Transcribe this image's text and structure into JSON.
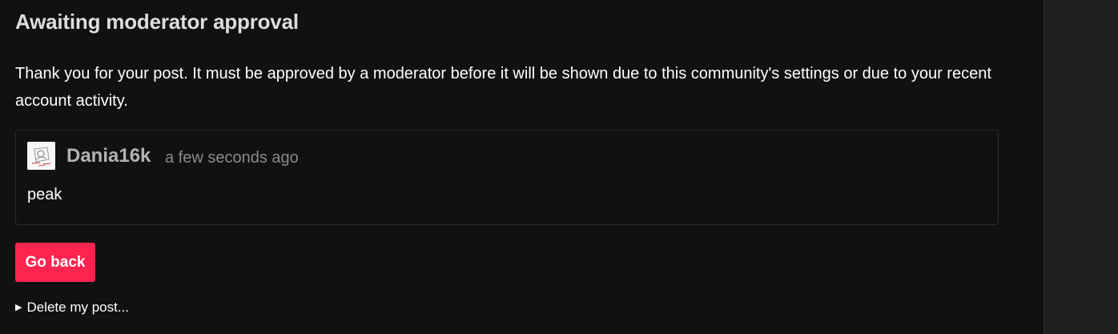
{
  "page": {
    "title": "Awaiting moderator approval",
    "message": "Thank you for your post. It must be approved by a moderator before it will be shown due to this community's settings or due to your recent account activity."
  },
  "post": {
    "author": "Dania16k",
    "timestamp": "a few seconds ago",
    "body": "peak",
    "avatar_icon": "user-avatar-sketch"
  },
  "actions": {
    "go_back_label": "Go back",
    "delete_label": "Delete my post...",
    "delete_toggle_icon": "disclosure-triangle-right"
  },
  "colors": {
    "background": "#111111",
    "sidebar": "#1e1e1e",
    "accent": "#ff2450",
    "muted_text": "#8a8a8a",
    "author_text": "#b3b3b3"
  }
}
